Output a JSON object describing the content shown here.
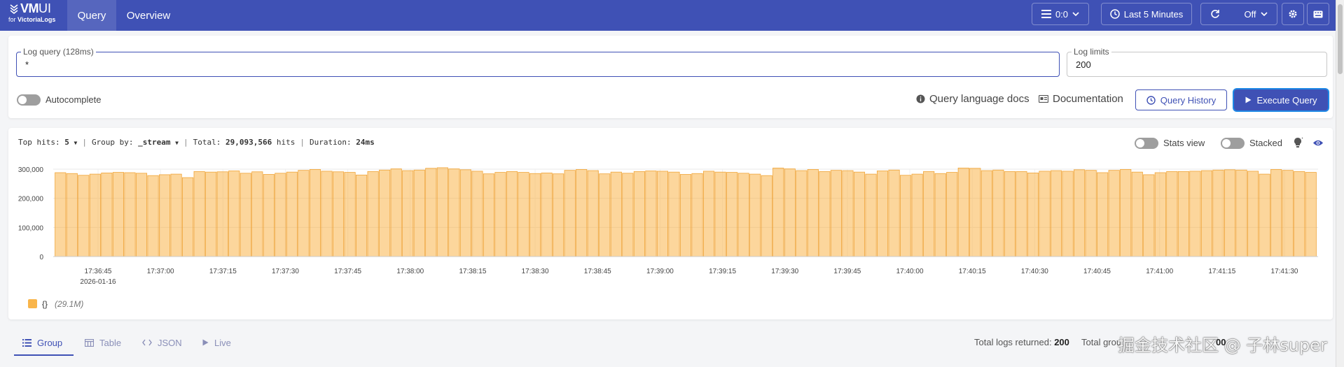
{
  "app": {
    "logo_main": "VM",
    "logo_ui": "UI",
    "logo_for": "for",
    "logo_brand": "VictoriaLogs"
  },
  "nav": {
    "tabs": [
      {
        "label": "Query",
        "active": true
      },
      {
        "label": "Overview",
        "active": false
      }
    ]
  },
  "header_controls": {
    "tenant": "0:0",
    "time_range": "Last 5 Minutes",
    "refresh": "Off"
  },
  "query": {
    "log_query_label": "Log query (128ms)",
    "log_query_value": "*",
    "log_limits_label": "Log limits",
    "log_limits_value": "200",
    "autocomplete_label": "Autocomplete",
    "autocomplete_enabled": false,
    "query_docs_label": "Query language docs",
    "documentation_label": "Documentation",
    "query_history_label": "Query History",
    "execute_label": "Execute Query"
  },
  "hits": {
    "top_hits_label": "Top hits:",
    "top_hits_value": "5",
    "group_by_label": "Group by:",
    "group_by_value": "_stream",
    "total_label": "Total:",
    "total_value": "29,093,566",
    "hits_suffix": "hits",
    "duration_label": "Duration:",
    "duration_value": "24ms",
    "stats_view_label": "Stats view",
    "stacked_label": "Stacked",
    "stats_view_enabled": false,
    "stacked_enabled": false
  },
  "chart_data": {
    "type": "bar",
    "title": "",
    "xlabel": "",
    "ylabel": "",
    "ylim": [
      0,
      300000
    ],
    "yticks": [
      0,
      100000,
      200000,
      300000
    ],
    "ytick_labels": [
      "300,000",
      "200,000",
      "100,000",
      "0"
    ],
    "xtick_labels": [
      "17:36:45",
      "17:37:00",
      "17:37:15",
      "17:37:30",
      "17:37:45",
      "17:38:00",
      "17:38:15",
      "17:38:30",
      "17:38:45",
      "17:39:00",
      "17:39:15",
      "17:39:30",
      "17:39:45",
      "17:40:00",
      "17:40:15",
      "17:40:30",
      "17:40:45",
      "17:41:00",
      "17:41:15",
      "17:41:30"
    ],
    "x_date_label": "2026-01-16",
    "grid": true,
    "legend_position": "bottom-left",
    "series": [
      {
        "name": "{}",
        "total_label": "(29.1M)",
        "color": "#f9b54a",
        "values": [
          288000,
          285000,
          279000,
          283000,
          287000,
          289000,
          288000,
          286000,
          278000,
          281000,
          283000,
          271000,
          292000,
          290000,
          291000,
          294000,
          286000,
          291000,
          282000,
          286000,
          290000,
          296000,
          299000,
          293000,
          291000,
          289000,
          280000,
          292000,
          297000,
          301000,
          295000,
          297000,
          303000,
          305000,
          301000,
          298000,
          293000,
          284000,
          289000,
          292000,
          289000,
          285000,
          287000,
          284000,
          296000,
          299000,
          295000,
          284000,
          290000,
          286000,
          292000,
          294000,
          293000,
          290000,
          282000,
          285000,
          293000,
          290000,
          289000,
          286000,
          283000,
          278000,
          304000,
          301000,
          295000,
          299000,
          292000,
          296000,
          295000,
          290000,
          283000,
          294000,
          297000,
          279000,
          283000,
          292000,
          285000,
          289000,
          304000,
          303000,
          295000,
          297000,
          292000,
          292000,
          287000,
          293000,
          295000,
          293000,
          298000,
          296000,
          288000,
          296000,
          299000,
          290000,
          281000,
          288000,
          292000,
          292000,
          293000,
          295000,
          297000,
          298000,
          297000,
          293000,
          283000,
          299000,
          296000,
          292000,
          289000
        ]
      }
    ]
  },
  "results": {
    "tabs": [
      {
        "label": "Group",
        "active": true
      },
      {
        "label": "Table",
        "active": false
      },
      {
        "label": "JSON",
        "active": false
      },
      {
        "label": "Live",
        "active": false
      }
    ],
    "total_logs_label": "Total logs returned:",
    "total_logs_value": "200",
    "total_groups_label": "Total grou",
    "total_groups_value": "00"
  },
  "watermark": "掘金技术社区 @ 子林super",
  "colors": {
    "brand": "#3f51b5",
    "bar": "#f9b54a",
    "bar_stroke": "#f0a437"
  }
}
